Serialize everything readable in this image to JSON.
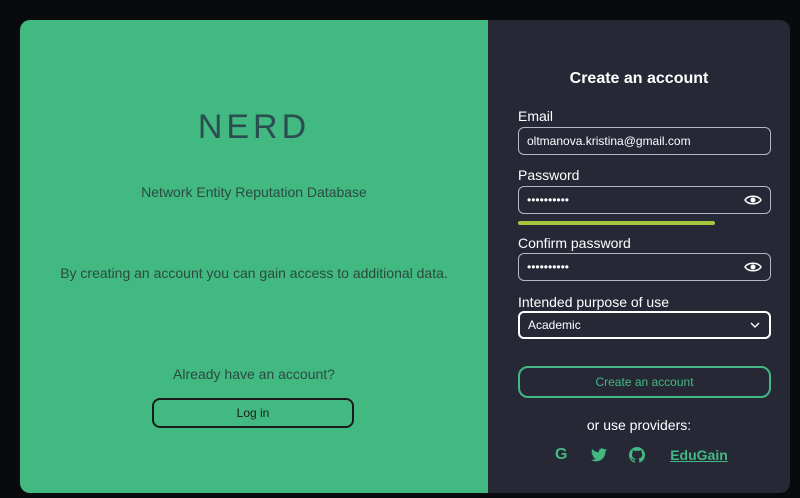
{
  "left": {
    "logo": "NERD",
    "subtitle": "Network Entity Reputation Database",
    "info": "By creating an account you can gain access to additional data.",
    "already": "Already have an account?",
    "login_label": "Log in"
  },
  "form": {
    "title": "Create an account",
    "email_label": "Email",
    "email_value": "oltmanova.kristina@gmail.com",
    "password_label": "Password",
    "password_value": "••••••••••",
    "confirm_label": "Confirm password",
    "confirm_value": "••••••••••",
    "purpose_label": "Intended purpose of use",
    "purpose_value": "Academic",
    "submit_label": "Create an account",
    "password_strength": 0.78
  },
  "providers": {
    "label": "or use providers:",
    "google_glyph": "G",
    "edugain_label": "EduGain",
    "icons": [
      "google-icon",
      "twitter-icon",
      "github-icon"
    ]
  },
  "colors": {
    "accent": "#43b982",
    "panel_dark": "#272836",
    "strength_bar": "#a7c73f"
  }
}
